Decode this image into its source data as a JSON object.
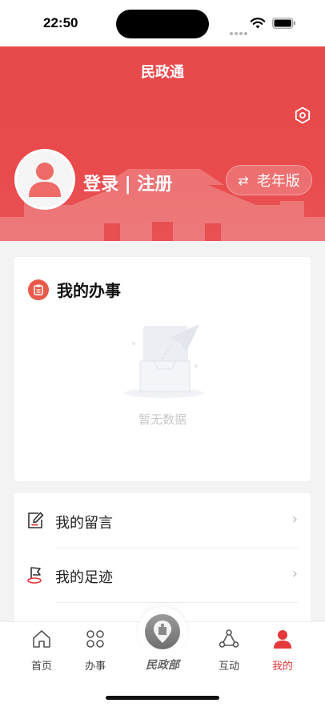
{
  "status": {
    "time": "22:50"
  },
  "header": {
    "title": "民政通",
    "login_label": "登录 | 注册",
    "elder_mode_label": "老年版",
    "accent": "#e84a4b"
  },
  "affairs": {
    "title": "我的办事",
    "empty_text": "暂无数据"
  },
  "list": [
    {
      "label": "我的留言",
      "icon": "edit-note-icon"
    },
    {
      "label": "我的足迹",
      "icon": "footprint-icon"
    }
  ],
  "tabs": [
    {
      "label": "首页",
      "icon": "home-icon"
    },
    {
      "label": "办事",
      "icon": "grid-icon"
    },
    {
      "label": "民政部",
      "icon": "ministry-logo-icon"
    },
    {
      "label": "互动",
      "icon": "share-nodes-icon"
    },
    {
      "label": "我的",
      "icon": "user-icon",
      "active": true
    }
  ]
}
